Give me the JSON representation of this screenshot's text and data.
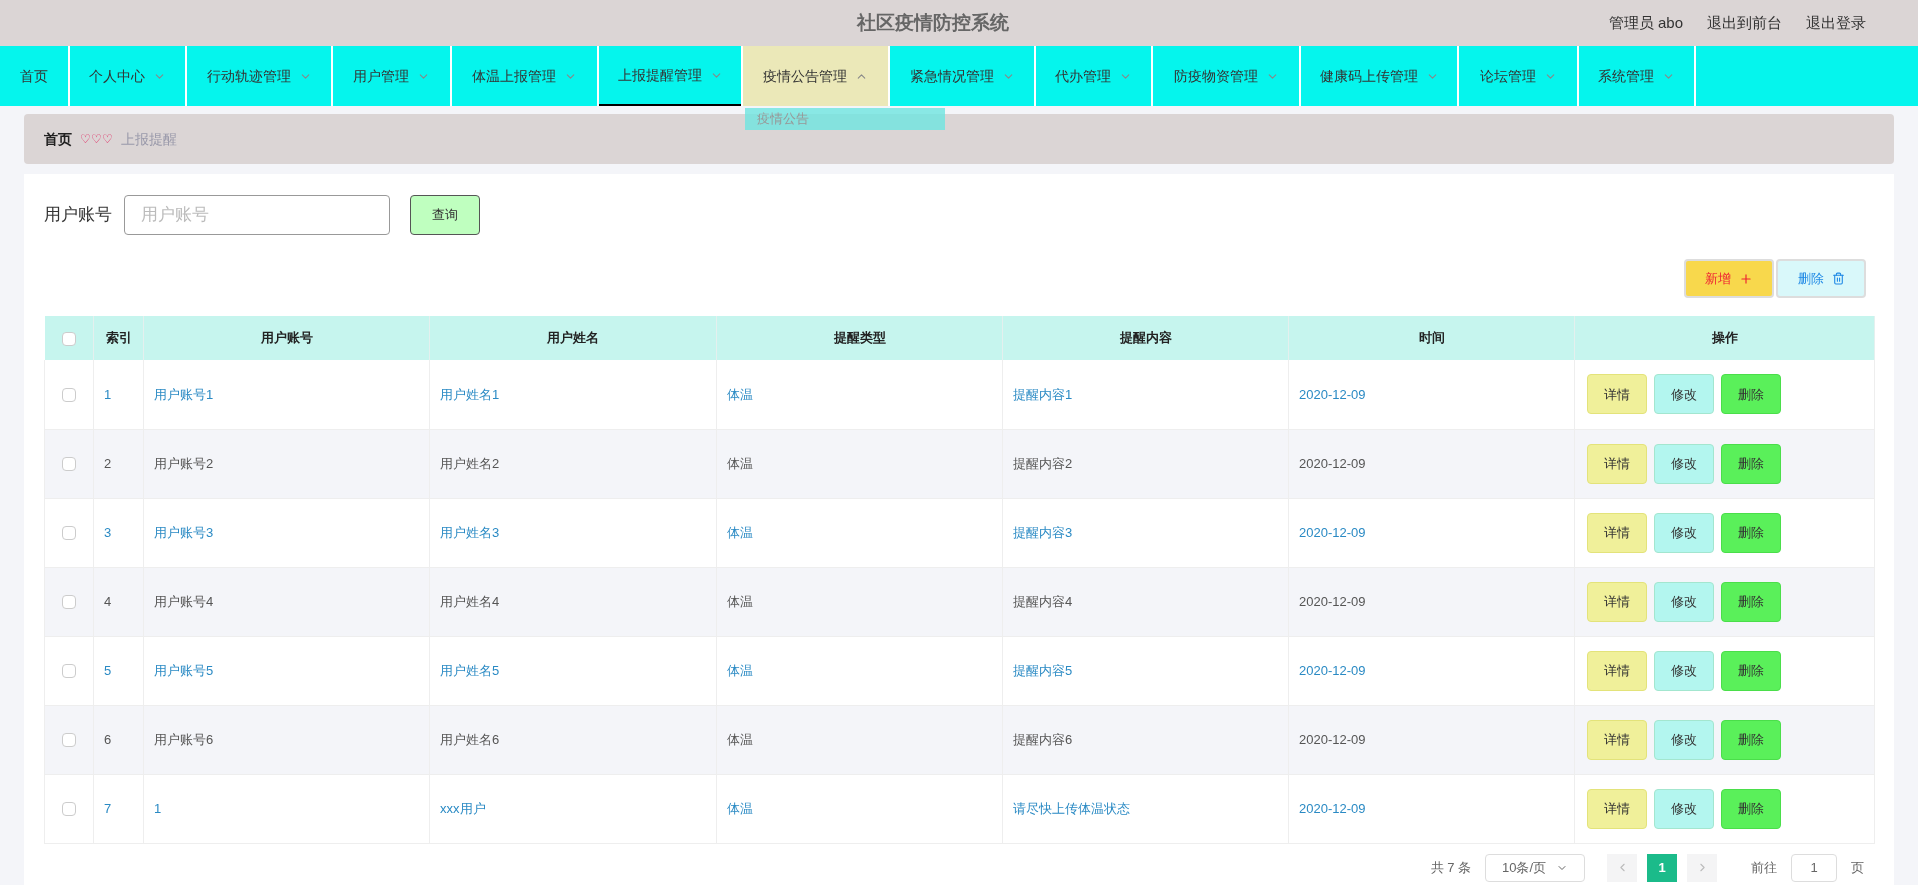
{
  "header": {
    "title": "社区疫情防控系统",
    "user": "管理员 abo",
    "links": [
      "退出到前台",
      "退出登录"
    ]
  },
  "nav": [
    {
      "label": "首页",
      "has_menu": false,
      "selected": false,
      "expanded": false
    },
    {
      "label": "个人中心",
      "has_menu": true,
      "selected": false,
      "expanded": false
    },
    {
      "label": "行动轨迹管理",
      "has_menu": true,
      "selected": false,
      "expanded": false
    },
    {
      "label": "用户管理",
      "has_menu": true,
      "selected": false,
      "expanded": false
    },
    {
      "label": "体温上报管理",
      "has_menu": true,
      "selected": false,
      "expanded": false
    },
    {
      "label": "上报提醒管理",
      "has_menu": true,
      "selected": true,
      "expanded": false
    },
    {
      "label": "疫情公告管理",
      "has_menu": true,
      "selected": false,
      "expanded": true,
      "menu": [
        "疫情公告"
      ]
    },
    {
      "label": "紧急情况管理",
      "has_menu": true,
      "selected": false,
      "expanded": false
    },
    {
      "label": "代办管理",
      "has_menu": true,
      "selected": false,
      "expanded": false
    },
    {
      "label": "防疫物资管理",
      "has_menu": true,
      "selected": false,
      "expanded": false
    },
    {
      "label": "健康码上传管理",
      "has_menu": true,
      "selected": false,
      "expanded": false
    },
    {
      "label": "论坛管理",
      "has_menu": true,
      "selected": false,
      "expanded": false
    },
    {
      "label": "系统管理",
      "has_menu": true,
      "selected": false,
      "expanded": false
    }
  ],
  "breadcrumb": {
    "home": "首页",
    "separator": "♡♡♡",
    "current": "上报提醒"
  },
  "search": {
    "label": "用户账号",
    "placeholder": "用户账号",
    "button": "查询"
  },
  "actions": {
    "add": "新增",
    "delete": "删除"
  },
  "table": {
    "columns": [
      "索引",
      "用户账号",
      "用户姓名",
      "提醒类型",
      "提醒内容",
      "时间",
      "操作"
    ],
    "select_all_checked": false,
    "rows": [
      {
        "cells": [
          "1",
          "用户账号1",
          "用户姓名1",
          "体温",
          "提醒内容1",
          "2020-12-09"
        ],
        "buttons": [
          "详情",
          "修改",
          "删除"
        ],
        "highlighted": true,
        "checked": false
      },
      {
        "cells": [
          "2",
          "用户账号2",
          "用户姓名2",
          "体温",
          "提醒内容2",
          "2020-12-09"
        ],
        "buttons": [
          "详情",
          "修改",
          "删除"
        ],
        "highlighted": false,
        "checked": false
      },
      {
        "cells": [
          "3",
          "用户账号3",
          "用户姓名3",
          "体温",
          "提醒内容3",
          "2020-12-09"
        ],
        "buttons": [
          "详情",
          "修改",
          "删除"
        ],
        "highlighted": true,
        "checked": false
      },
      {
        "cells": [
          "4",
          "用户账号4",
          "用户姓名4",
          "体温",
          "提醒内容4",
          "2020-12-09"
        ],
        "buttons": [
          "详情",
          "修改",
          "删除"
        ],
        "highlighted": false,
        "checked": false
      },
      {
        "cells": [
          "5",
          "用户账号5",
          "用户姓名5",
          "体温",
          "提醒内容5",
          "2020-12-09"
        ],
        "buttons": [
          "详情",
          "修改",
          "删除"
        ],
        "highlighted": true,
        "checked": false
      },
      {
        "cells": [
          "6",
          "用户账号6",
          "用户姓名6",
          "体温",
          "提醒内容6",
          "2020-12-09"
        ],
        "buttons": [
          "详情",
          "修改",
          "删除"
        ],
        "highlighted": false,
        "checked": false
      },
      {
        "cells": [
          "7",
          "1",
          "xxx用户",
          "体温",
          "请尽快上传体温状态",
          "2020-12-09"
        ],
        "buttons": [
          "详情",
          "修改",
          "删除"
        ],
        "highlighted": true,
        "checked": false
      }
    ]
  },
  "pagination": {
    "total": "共 7 条",
    "page_size": "10条/页",
    "pages": [
      {
        "label": "1",
        "selected": true
      }
    ],
    "goto_label": "前往",
    "goto_value": "1",
    "goto_suffix": "页"
  }
}
